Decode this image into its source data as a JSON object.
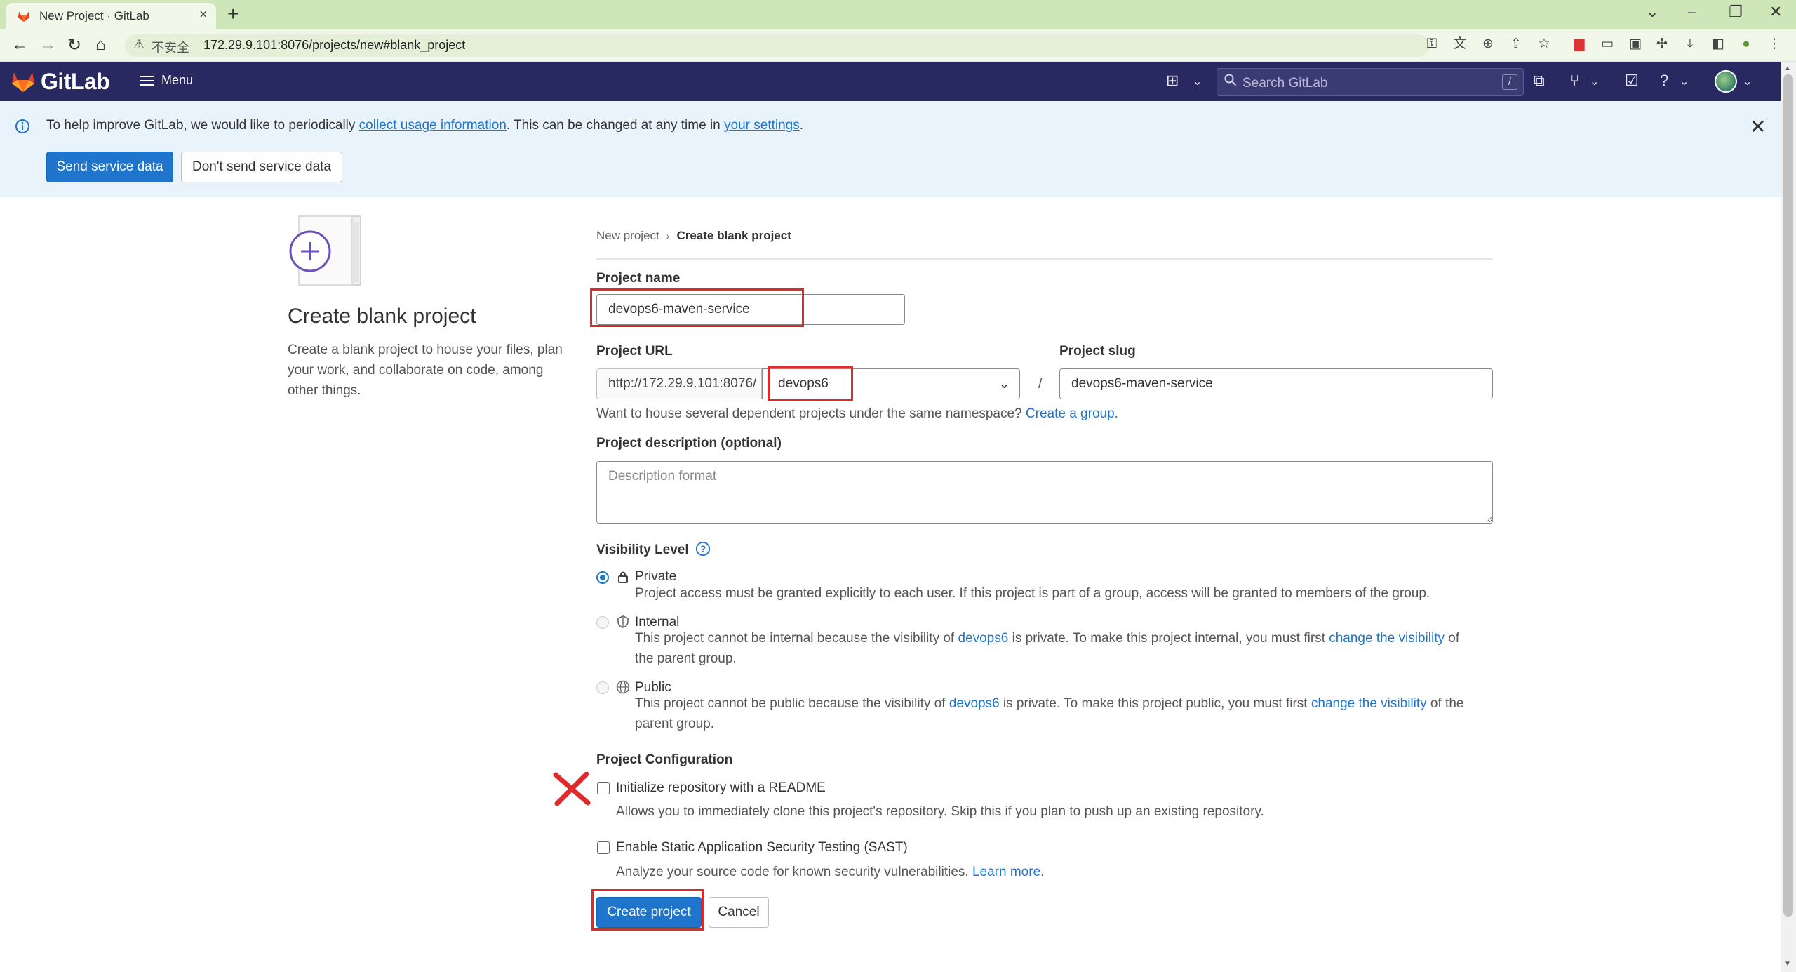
{
  "browser": {
    "tab_title": "New Project · GitLab",
    "insecure_label": "不安全",
    "url": "172.29.9.101:8076/projects/new#blank_project"
  },
  "header": {
    "brand": "GitLab",
    "menu_label": "Menu",
    "search_placeholder": "Search GitLab",
    "search_shortcut": "/"
  },
  "banner": {
    "text_before": "To help improve GitLab, we would like to periodically ",
    "link1": "collect usage information",
    "text_middle": ". This can be changed at any time in ",
    "link2": "your settings",
    "text_after": ".",
    "send_button": "Send service data",
    "dont_send_button": "Don't send service data"
  },
  "left": {
    "title": "Create blank project",
    "description": "Create a blank project to house your files, plan your work, and collaborate on code, among other things."
  },
  "breadcrumb": {
    "parent": "New project",
    "current": "Create blank project"
  },
  "form": {
    "project_name_label": "Project name",
    "project_name_value": "devops6-maven-service",
    "project_url_label": "Project URL",
    "url_prefix": "http://172.29.9.101:8076/",
    "namespace_value": "devops6",
    "slash": "/",
    "project_slug_label": "Project slug",
    "project_slug_value": "devops6-maven-service",
    "group_help_text": "Want to house several dependent projects under the same namespace?",
    "group_help_link": "Create a group.",
    "description_label": "Project description (optional)",
    "description_placeholder": "Description format",
    "visibility_label": "Visibility Level",
    "visibility": {
      "private_title": "Private",
      "private_desc": "Project access must be granted explicitly to each user. If this project is part of a group, access will be granted to members of the group.",
      "internal_title": "Internal",
      "internal_desc_1": "This project cannot be internal because the visibility of ",
      "internal_link_group": "devops6",
      "internal_desc_2": " is private. To make this project internal, you must first ",
      "internal_link_change": "change the visibility",
      "internal_desc_3": " of the parent group.",
      "public_title": "Public",
      "public_desc_1": "This project cannot be public because the visibility of ",
      "public_link_group": "devops6",
      "public_desc_2": " is private. To make this project public, you must first ",
      "public_link_change": "change the visibility",
      "public_desc_3": " of the parent group."
    },
    "config_label": "Project Configuration",
    "readme_label": "Initialize repository with a README",
    "readme_help": "Allows you to immediately clone this project's repository. Skip this if you plan to push up an existing repository.",
    "sast_label": "Enable Static Application Security Testing (SAST)",
    "sast_help": "Analyze your source code for known security vulnerabilities.",
    "sast_link": "Learn more.",
    "create_button": "Create project",
    "cancel_button": "Cancel"
  },
  "colors": {
    "gitlab_header": "#292961",
    "primary_blue": "#1f75cb",
    "banner_bg": "#e9f3fc",
    "annotation_red": "#dd2b2b",
    "browser_chrome": "#cfe6b8"
  }
}
